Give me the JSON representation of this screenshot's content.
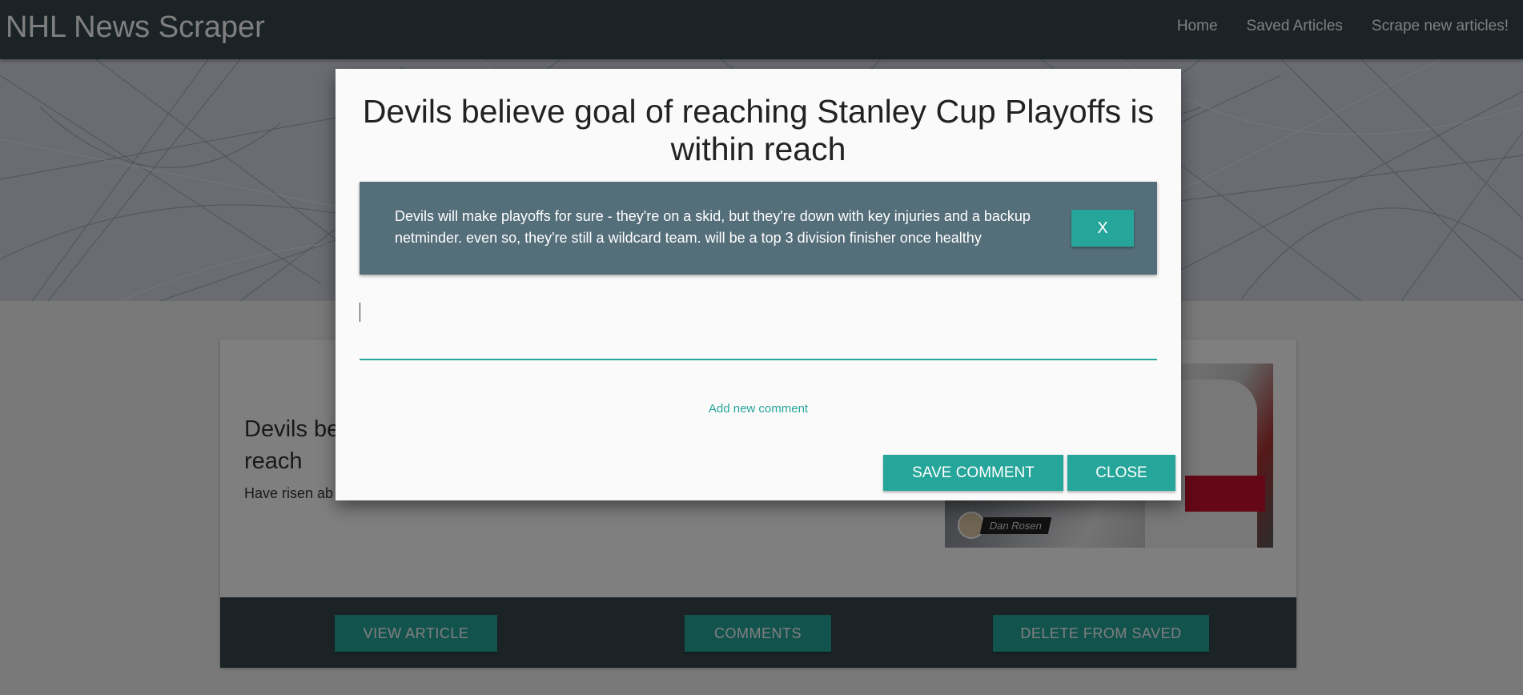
{
  "navbar": {
    "brand": "NHL News Scraper",
    "links": [
      "Home",
      "Saved Articles",
      "Scrape new articles!"
    ]
  },
  "article": {
    "title": "Devils believe goal of reaching Stanley Cup Playoffs is within reach",
    "summary_visible": "Have risen ab",
    "author": "Dan Rosen",
    "actions": {
      "view": "VIEW ARTICLE",
      "comments": "COMMENTS",
      "delete": "DELETE FROM SAVED"
    }
  },
  "modal": {
    "title": "Devils believe goal of reaching Stanley Cup Playoffs is within reach",
    "comment": "Devils will make playoffs for sure - they're on a skid, but they're down with key injuries and a backup netminder. even so, they're still a wildcard team. will be a top 3 division finisher once healthy",
    "delete_comment_label": "X",
    "input_value": "",
    "input_label": "Add new comment",
    "save_label": "SAVE COMMENT",
    "close_label": "CLOSE"
  },
  "colors": {
    "navbar": "#37474f",
    "accent": "#26a69a",
    "comment_bg": "#546e7a"
  }
}
